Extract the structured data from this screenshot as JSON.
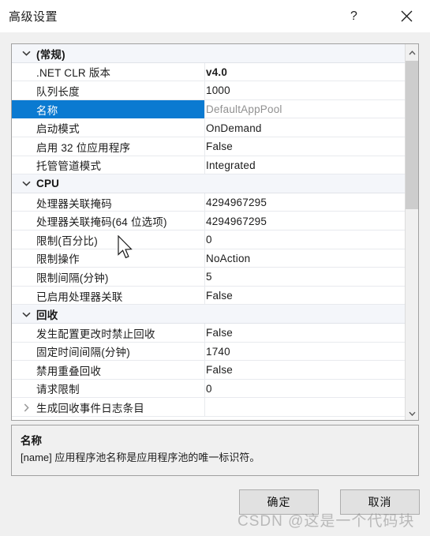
{
  "window": {
    "title": "高级设置",
    "help_icon": "question-mark-icon",
    "close_icon": "close-x-icon"
  },
  "grid": {
    "rows": [
      {
        "type": "category",
        "chevron": "chevron-down-icon",
        "name": "(常规)",
        "value": ""
      },
      {
        "type": "property",
        "name": ".NET CLR 版本",
        "value": "v4.0",
        "bold": true
      },
      {
        "type": "property",
        "name": "队列长度",
        "value": "1000"
      },
      {
        "type": "property",
        "name": "名称",
        "value": "DefaultAppPool",
        "selected": true,
        "muted": true
      },
      {
        "type": "property",
        "name": "启动模式",
        "value": "OnDemand"
      },
      {
        "type": "property",
        "name": "启用 32 位应用程序",
        "value": "False"
      },
      {
        "type": "property",
        "name": "托管管道模式",
        "value": "Integrated"
      },
      {
        "type": "category",
        "chevron": "chevron-down-icon",
        "name": "CPU",
        "value": ""
      },
      {
        "type": "property",
        "name": "处理器关联掩码",
        "value": "4294967295"
      },
      {
        "type": "property",
        "name": "处理器关联掩码(64 位选项)",
        "value": "4294967295"
      },
      {
        "type": "property",
        "name": "限制(百分比)",
        "value": "0"
      },
      {
        "type": "property",
        "name": "限制操作",
        "value": "NoAction"
      },
      {
        "type": "property",
        "name": "限制间隔(分钟)",
        "value": "5"
      },
      {
        "type": "property",
        "name": "已启用处理器关联",
        "value": "False"
      },
      {
        "type": "category",
        "chevron": "chevron-down-icon",
        "name": "回收",
        "value": ""
      },
      {
        "type": "property",
        "name": "发生配置更改时禁止回收",
        "value": "False"
      },
      {
        "type": "property",
        "name": "固定时间间隔(分钟)",
        "value": "1740"
      },
      {
        "type": "property",
        "name": "禁用重叠回收",
        "value": "False"
      },
      {
        "type": "property",
        "name": "请求限制",
        "value": "0"
      },
      {
        "type": "property",
        "chevron": "chevron-right-icon",
        "name": "生成回收事件日志条目",
        "value": ""
      }
    ],
    "scrollbar": {
      "up_icon": "chevron-up-icon",
      "down_icon": "chevron-down-icon"
    }
  },
  "description": {
    "title": "名称",
    "text": "[name] 应用程序池名称是应用程序池的唯一标识符。"
  },
  "buttons": {
    "ok": "确定",
    "cancel": "取消"
  },
  "watermark": {
    "text": "CSDN @这是一个代码块"
  },
  "colors": {
    "selection": "#0a7ad1",
    "category_bg": "#f4f6fa",
    "dialog_bg": "#f0f0f0",
    "button_bg": "#e1e1e1",
    "scrollbar_thumb": "#cdcdcd"
  },
  "cursor": {
    "icon": "arrow-pointer-cursor"
  }
}
